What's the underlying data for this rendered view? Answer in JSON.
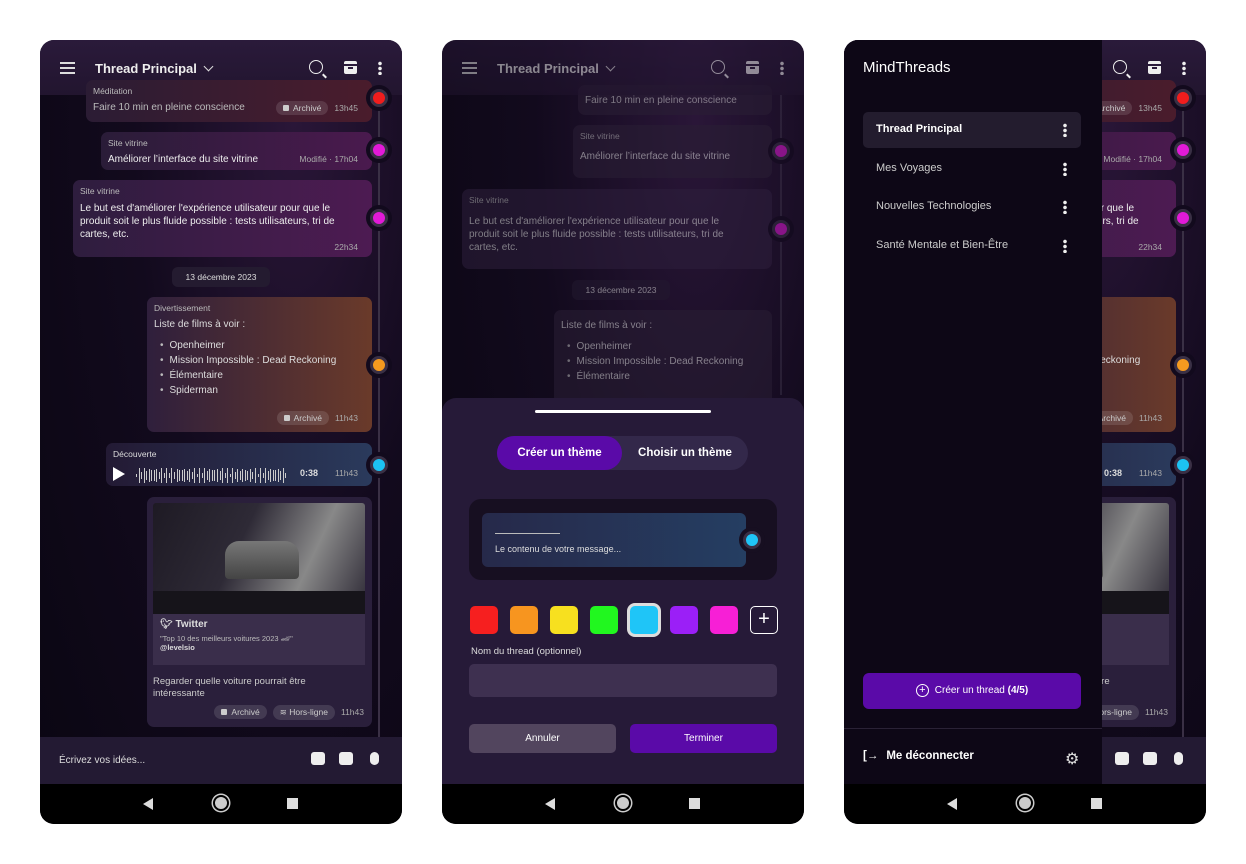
{
  "header": {
    "title": "Thread Principal"
  },
  "messages": [
    {
      "category": "Méditation",
      "text": "Faire 10 min en pleine conscience",
      "status": "Archivé",
      "time": "13h45",
      "color": "#f01d1d"
    },
    {
      "category": "Site vitrine",
      "text": "Améliorer l’interface du site vitrine",
      "status": "Modifié",
      "time": "17h04",
      "color": "#e21ad8"
    },
    {
      "category": "Site vitrine",
      "text": "Le but est d'améliorer l'expérience utilisateur pour que le produit soit le plus fluide possible : tests utilisateurs, tri de cartes, etc.",
      "time": "22h34",
      "color": "#e21ad8"
    },
    {
      "category": "Divertissement",
      "text": "Liste de films à voir :",
      "items": [
        "Openheimer",
        "Mission Impossible : Dead Reckoning",
        "Élémentaire",
        "Spiderman"
      ],
      "status": "Archivé",
      "time": "11h43",
      "color": "#f59a1f"
    },
    {
      "category": "Découverte",
      "duration": "0:38",
      "time": "11h43",
      "color": "#1cc2f2"
    },
    {
      "link_source": "Twitter",
      "link_title": "\"Top 10 des meilleurs voitures 2023 🏎\"",
      "link_author": "@levelsio",
      "text": "Regarder quelle voiture pourrait être intéressante",
      "status": "Archivé",
      "offline": "Hors-ligne",
      "time": "11h43"
    }
  ],
  "date_separator": "13 décembre 2023",
  "composer": {
    "placeholder": "Écrivez vos idées..."
  },
  "theme_sheet": {
    "tabs": [
      "Créer un thème",
      "Choisir un thème"
    ],
    "active_tab": "Créer un thème",
    "preview_text": "Le contenu de votre message...",
    "swatches": [
      "#f61f1f",
      "#f7951f",
      "#f7e01f",
      "#21f71f",
      "#1fc5f7",
      "#9b1ff7",
      "#f71fd6"
    ],
    "selected_swatch": "#1fc5f7",
    "name_label": "Nom du thread (optionnel)",
    "name_value": "",
    "cancel": "Annuler",
    "confirm": "Terminer"
  },
  "drawer": {
    "app_name": "MindThreads",
    "threads": [
      "Thread Principal",
      "Mes Voyages",
      "Nouvelles Technologies",
      "Santé Mentale et Bien-Être"
    ],
    "active_thread": "Thread Principal",
    "create_label": "Créer un thread",
    "create_count": "(4/5)",
    "logout": "Me déconnecter"
  },
  "colors": {
    "accent": "#5a0aa8",
    "background": "#120a1d"
  }
}
